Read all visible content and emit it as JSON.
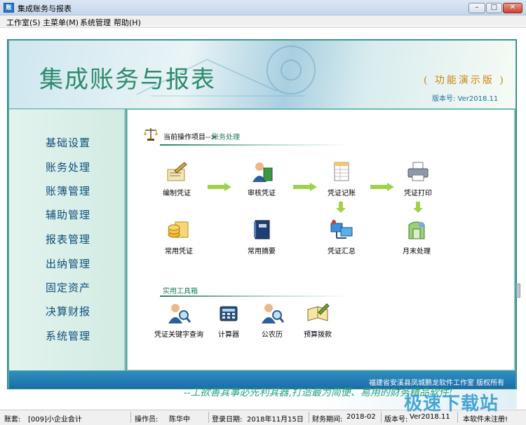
{
  "window": {
    "title": "集成账务与报表",
    "icon_text": "账",
    "min_label": "–",
    "max_label": "□",
    "close_label": "✕"
  },
  "menu": [
    "工作室(S)",
    "主菜单(M)",
    "系统管理",
    "帮助(H)"
  ],
  "banner": {
    "title": "集成账务与报表",
    "subtitle": "( 功能演示版 )",
    "version": "版本号: Ver2018.11"
  },
  "sidebar": [
    {
      "label": "基础设置"
    },
    {
      "label": "账务处理"
    },
    {
      "label": "账簿管理"
    },
    {
      "label": "辅助管理"
    },
    {
      "label": "报表管理"
    },
    {
      "label": "出纳管理"
    },
    {
      "label": "固定资产"
    },
    {
      "label": "决算财报"
    },
    {
      "label": "系统管理"
    }
  ],
  "breadcrumb": {
    "label": "当前操作项目-->",
    "value": "账务处理"
  },
  "workflow": [
    {
      "label": "编制凭证",
      "icon": "pen-document-icon"
    },
    {
      "label": "审核凭证",
      "icon": "person-book-icon"
    },
    {
      "label": "凭证记账",
      "icon": "ledger-sheet-icon"
    },
    {
      "label": "凭证打印",
      "icon": "printer-icon"
    },
    {
      "label": "常用凭证",
      "icon": "coins-voucher-icon"
    },
    {
      "label": "常用摘要",
      "icon": "notebook-icon"
    },
    {
      "label": "凭证汇总",
      "icon": "network-summary-icon"
    },
    {
      "label": "月末处理",
      "icon": "month-end-icon"
    }
  ],
  "tools": {
    "title": "实用工具箱",
    "items": [
      {
        "label": "凭证关键字查询",
        "icon": "person-search-icon"
      },
      {
        "label": "计算器",
        "icon": "calculator-icon"
      },
      {
        "label": "公农历",
        "icon": "calendar-person-icon"
      },
      {
        "label": "预算拨款",
        "icon": "budget-book-icon"
      }
    ]
  },
  "footer": {
    "copyright": "福建省安溪县凤城鹏龙软件工作室 版权所有",
    "slogan": "--工欲善其事必先利其器,打造最为简便、易用的财务精品软件!"
  },
  "status": {
    "account_label": "账套:",
    "account_value": "[009]小企业会计",
    "operator_label": "操作员:",
    "operator_value": "陈华中",
    "login_label": "登录日期:",
    "login_value": "2018年11月15日",
    "period_label": "财务期间:",
    "period_value": "2018-02",
    "version_label": "版本号:",
    "version_value": "Ver2018.11",
    "reg_value": "本软件未注册!"
  },
  "watermark": "极速下载站",
  "colors": {
    "frame": "#4aa5a2",
    "sidebar_text": "#0d4f7c",
    "banner_title": "#2d8b6c",
    "accent_green": "#1e7b5c",
    "footer_blue": "#1b6ea8"
  }
}
